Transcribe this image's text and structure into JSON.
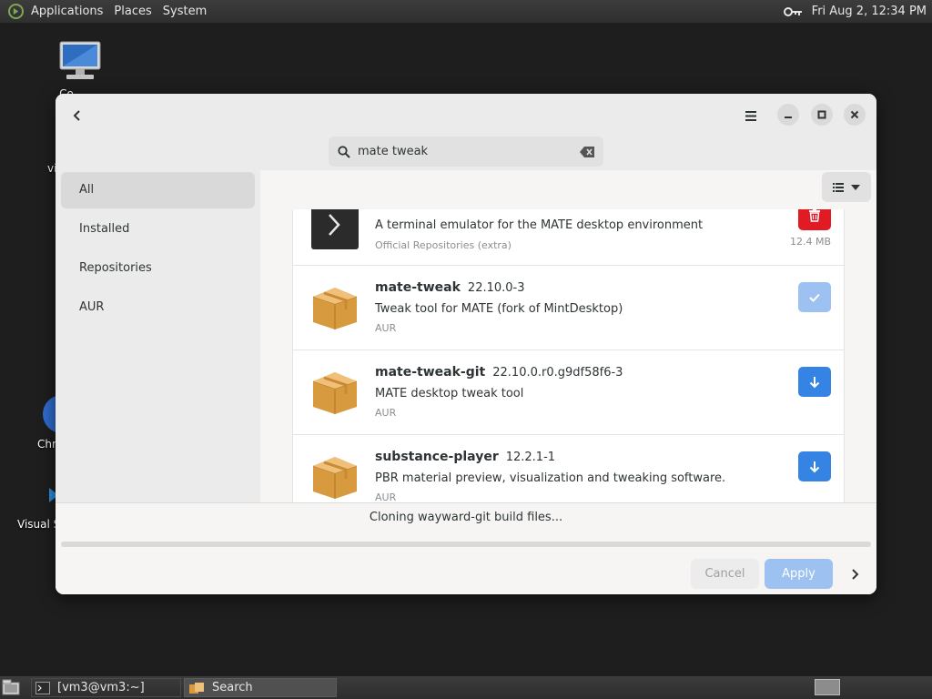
{
  "top_panel": {
    "menus": [
      "Applications",
      "Places",
      "System"
    ],
    "clock": "Fri Aug  2, 12:34 PM"
  },
  "desktop": {
    "icons": [
      {
        "label": "Co"
      },
      {
        "label": "vi"
      },
      {
        "label": "Chr"
      },
      {
        "label": "Visual S"
      }
    ]
  },
  "dialog": {
    "search": {
      "value": "mate tweak",
      "placeholder": ""
    },
    "sidebar": {
      "items": [
        {
          "label": "All",
          "active": true
        },
        {
          "label": "Installed",
          "active": false
        },
        {
          "label": "Repositories",
          "active": false
        },
        {
          "label": "AUR",
          "active": false
        }
      ]
    },
    "packages": [
      {
        "name": "",
        "version": "",
        "description": "A terminal emulator for the MATE desktop environment",
        "repo": "Official Repositories (extra)",
        "size": "12.4 MB",
        "action": "remove-icon"
      },
      {
        "name": "mate-tweak",
        "version": "22.10.0-3",
        "description": "Tweak tool for MATE (fork of MintDesktop)",
        "repo": "AUR",
        "action": "check-icon"
      },
      {
        "name": "mate-tweak-git",
        "version": "22.10.0.r0.g9df58f6-3",
        "description": "MATE desktop tweak tool",
        "repo": "AUR",
        "action": "download-icon"
      },
      {
        "name": "substance-player",
        "version": "12.2.1-1",
        "description": "PBR material preview, visualization and tweaking software.",
        "repo": "AUR",
        "action": "download-icon"
      }
    ],
    "status": "Cloning wayward-git build files...",
    "progress": 0,
    "buttons": {
      "cancel": "Cancel",
      "apply": "Apply"
    }
  },
  "taskbar": {
    "tasks": [
      {
        "label": "[vm3@vm3:~]"
      },
      {
        "label": "Search"
      }
    ]
  },
  "colors": {
    "accent": "#3584e4",
    "accent_disabled": "#9dc1f0",
    "destructive": "#e01b24"
  }
}
